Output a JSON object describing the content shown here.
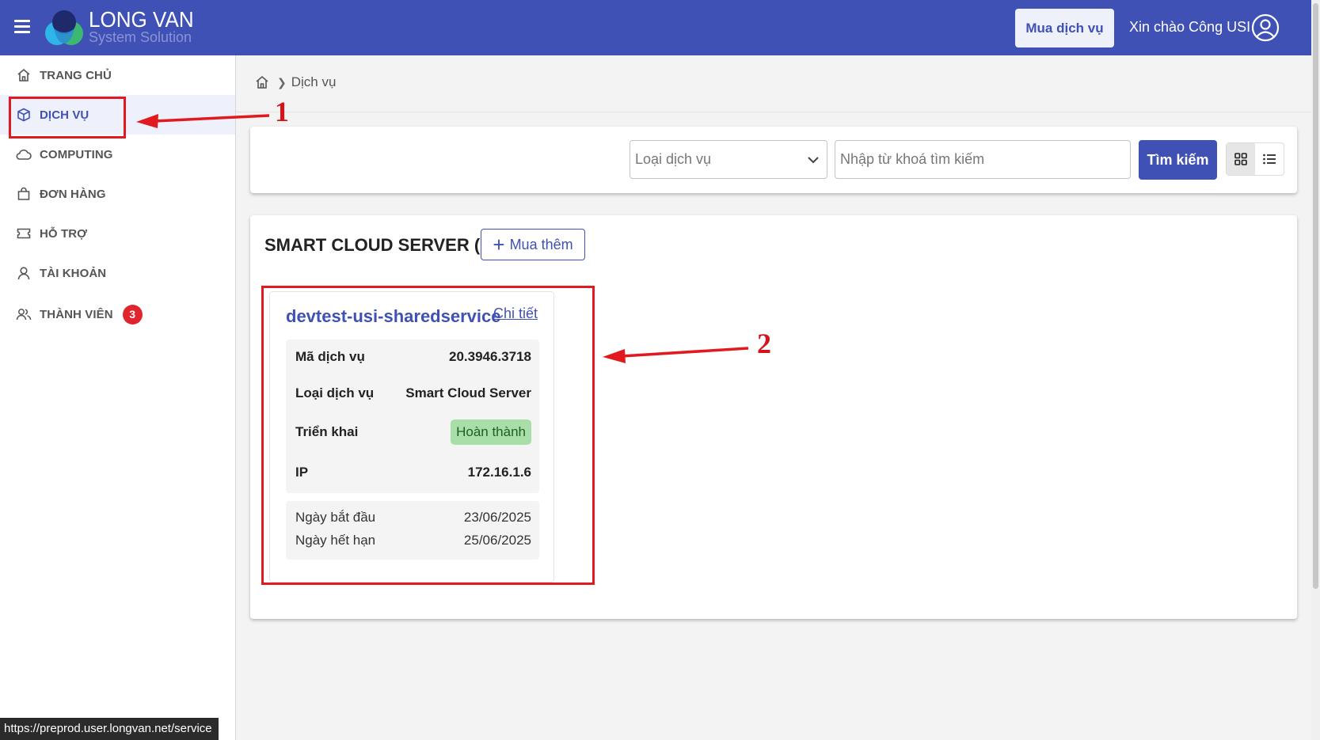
{
  "app": {
    "brand_name": "LONG VAN",
    "brand_sub": "System Solution"
  },
  "header": {
    "buy_button": "Mua dịch vụ",
    "greeting": "Xin chào Công USI"
  },
  "sidebar": {
    "items": [
      {
        "label": "TRANG CHỦ",
        "icon": "home-icon"
      },
      {
        "label": "DỊCH VỤ",
        "icon": "cube-icon",
        "active": true
      },
      {
        "label": "COMPUTING",
        "icon": "cloud-icon"
      },
      {
        "label": "ĐƠN HÀNG",
        "icon": "shopping-bag-icon"
      },
      {
        "label": "HỖ TRỢ",
        "icon": "ticket-icon"
      },
      {
        "label": "TÀI KHOẢN",
        "icon": "user-icon"
      },
      {
        "label": "THÀNH VIÊN",
        "icon": "users-icon",
        "badge": "3"
      }
    ]
  },
  "breadcrumb": {
    "current": "Dịch vụ"
  },
  "search": {
    "type_placeholder": "Loại dịch vụ",
    "keyword_placeholder": "Nhập từ khoá tìm kiếm",
    "button": "Tìm kiếm"
  },
  "section": {
    "title": "SMART CLOUD SERVER (1)",
    "more_button": "Mua thêm"
  },
  "service": {
    "name": "devtest-usi-sharedservice",
    "detail_link": "Chi tiết",
    "fields": [
      {
        "label": "Mã dịch vụ",
        "value": "20.3946.3718"
      },
      {
        "label": "Loại dịch vụ",
        "value": "Smart Cloud Server"
      },
      {
        "label": "Triển khai",
        "value": "Hoàn thành"
      },
      {
        "label": "IP",
        "value": "172.16.1.6"
      }
    ],
    "dates": [
      {
        "label": "Ngày bắt đầu",
        "value": "23/06/2025"
      },
      {
        "label": "Ngày hết hạn",
        "value": "25/06/2025"
      }
    ]
  },
  "annotations": {
    "one": "1",
    "two": "2"
  },
  "status_bar": {
    "url": "https://preprod.user.longvan.net/service"
  },
  "colors": {
    "primary": "#3f51b5",
    "annotation_red": "#e11a1f",
    "success_bg": "#a8dfa9",
    "badge_red": "#e0262c"
  }
}
